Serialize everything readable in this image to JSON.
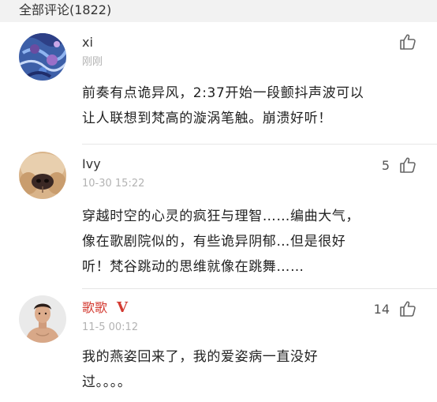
{
  "header": {
    "title": "全部评论(1822)"
  },
  "comments": [
    {
      "user": "xi",
      "time": "刚刚",
      "likes": "",
      "text": "前奏有点诡异风，2:37开始一段颤抖声波可以\n让人联想到梵高的漩涡笔触。崩溃好听！",
      "avatar_icon": "abstract-blue-painting-avatar",
      "like_icon": "thumbs-up-icon"
    },
    {
      "user": "Ivy",
      "time": "10-30 15:22",
      "likes": "5",
      "text": "穿越时空的心灵的疯狂与理智……编曲大气，\n像在歌剧院似的，有些诡异阴郁…但是很好\n听！梵谷跳动的思维就像在跳舞……",
      "avatar_icon": "dog-nose-avatar",
      "like_icon": "thumbs-up-icon"
    },
    {
      "user": "歌歌",
      "user_badge": "V",
      "time": "11-5 00:12",
      "likes": "14",
      "text": "我的燕姿回来了，我的爱姿病一直没好\n过。。。。",
      "avatar_icon": "man-portrait-avatar",
      "like_icon": "thumbs-up-icon"
    }
  ],
  "colors": {
    "header_bg": "#f2f2f2",
    "vip_name": "#d33a31",
    "muted": "#b3b3b3",
    "text": "#222222"
  }
}
